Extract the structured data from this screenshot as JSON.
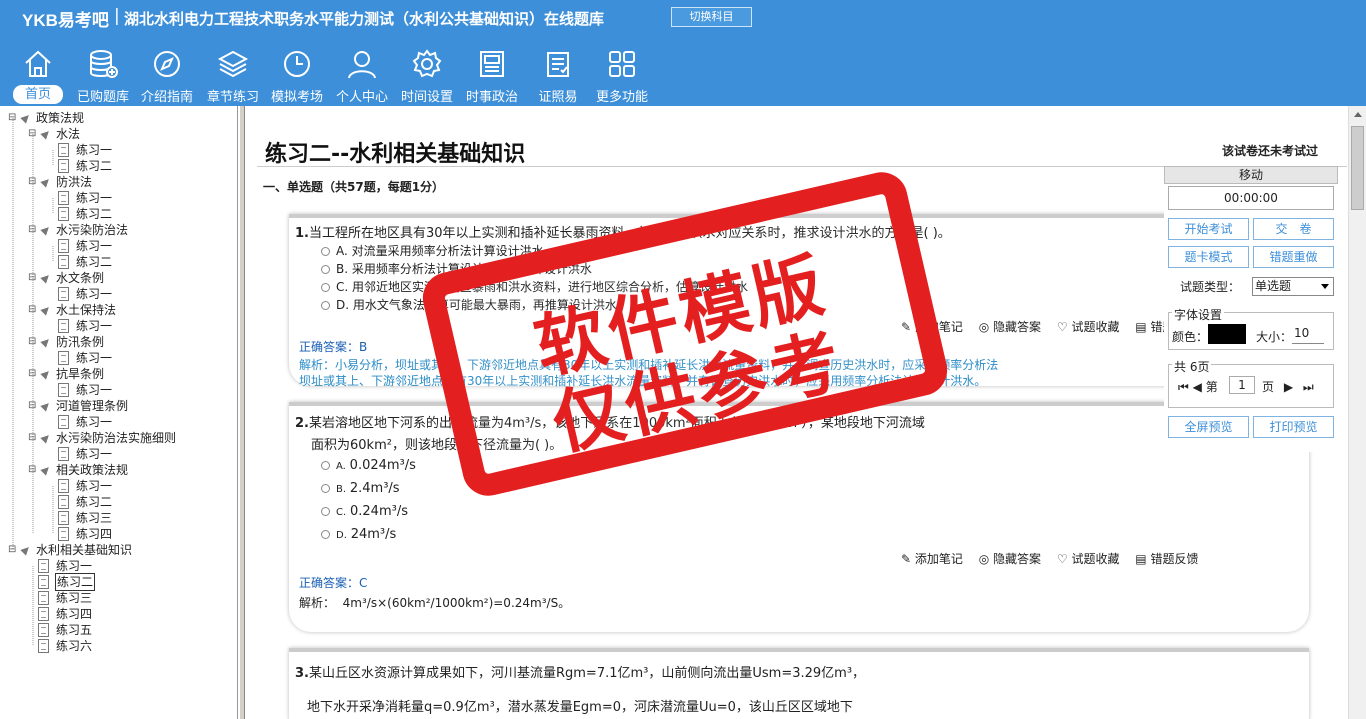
{
  "header": {
    "logo": "YKB易考吧",
    "title": "湖北水利电力工程技术职务水平能力测试（水利公共基础知识）在线题库",
    "switch_label": "切换科目"
  },
  "nav": [
    {
      "label": "首页",
      "icon": "home-icon"
    },
    {
      "label": "已购题库",
      "icon": "database-icon"
    },
    {
      "label": "介绍指南",
      "icon": "compass-icon"
    },
    {
      "label": "章节练习",
      "icon": "layers-icon"
    },
    {
      "label": "模拟考场",
      "icon": "clock-icon"
    },
    {
      "label": "个人中心",
      "icon": "user-icon"
    },
    {
      "label": "时间设置",
      "icon": "gear-icon"
    },
    {
      "label": "时事政治",
      "icon": "news-icon"
    },
    {
      "label": "证照易",
      "icon": "clipboard-icon"
    },
    {
      "label": "更多功能",
      "icon": "grid-icon"
    }
  ],
  "tree": [
    {
      "label": "政策法规",
      "level": 0,
      "kind": "folder"
    },
    {
      "label": "水法",
      "level": 1,
      "kind": "folder"
    },
    {
      "label": "练习一",
      "level": 2,
      "kind": "doc"
    },
    {
      "label": "练习二",
      "level": 2,
      "kind": "doc"
    },
    {
      "label": "防洪法",
      "level": 1,
      "kind": "folder"
    },
    {
      "label": "练习一",
      "level": 2,
      "kind": "doc"
    },
    {
      "label": "练习二",
      "level": 2,
      "kind": "doc"
    },
    {
      "label": "水污染防治法",
      "level": 1,
      "kind": "folder"
    },
    {
      "label": "练习一",
      "level": 2,
      "kind": "doc"
    },
    {
      "label": "练习二",
      "level": 2,
      "kind": "doc"
    },
    {
      "label": "水文条例",
      "level": 1,
      "kind": "folder"
    },
    {
      "label": "练习一",
      "level": 2,
      "kind": "doc"
    },
    {
      "label": "水土保持法",
      "level": 1,
      "kind": "folder"
    },
    {
      "label": "练习一",
      "level": 2,
      "kind": "doc"
    },
    {
      "label": "防汛条例",
      "level": 1,
      "kind": "folder"
    },
    {
      "label": "练习一",
      "level": 2,
      "kind": "doc"
    },
    {
      "label": "抗旱条例",
      "level": 1,
      "kind": "folder"
    },
    {
      "label": "练习一",
      "level": 2,
      "kind": "doc"
    },
    {
      "label": "河道管理条例",
      "level": 1,
      "kind": "folder"
    },
    {
      "label": "练习一",
      "level": 2,
      "kind": "doc"
    },
    {
      "label": "水污染防治法实施细则",
      "level": 1,
      "kind": "folder"
    },
    {
      "label": "练习一",
      "level": 2,
      "kind": "doc"
    },
    {
      "label": "相关政策法规",
      "level": 1,
      "kind": "folder"
    },
    {
      "label": "练习一",
      "level": 2,
      "kind": "doc"
    },
    {
      "label": "练习二",
      "level": 2,
      "kind": "doc"
    },
    {
      "label": "练习三",
      "level": 2,
      "kind": "doc"
    },
    {
      "label": "练习四",
      "level": 2,
      "kind": "doc"
    },
    {
      "label": "水利相关基础知识",
      "level": 0,
      "kind": "folder"
    },
    {
      "label": "练习一",
      "level": 1,
      "kind": "doc"
    },
    {
      "label": "练习二",
      "level": 1,
      "kind": "doc",
      "selected": true
    },
    {
      "label": "练习三",
      "level": 1,
      "kind": "doc"
    },
    {
      "label": "练习四",
      "level": 1,
      "kind": "doc"
    },
    {
      "label": "练习五",
      "level": 1,
      "kind": "doc"
    },
    {
      "label": "练习六",
      "level": 1,
      "kind": "doc"
    }
  ],
  "main": {
    "exam_title": "练习二--水利相关基础知识",
    "exam_status": "该试卷还未考试过",
    "section_title": "一、单选题（共57题，每题1分）",
    "q1": {
      "num": "1.",
      "text": "当工程所在地区具有30年以上实测和插补延长暴雨资料，并有暴雨洪水对应关系时，推求设计洪水的方法是(   )。",
      "options": [
        "A. 对流量采用频率分析法计算设计洪水",
        "B. 采用频率分析法计算设计暴雨，推算设计洪水",
        "C. 用邻近地区实测或调查暴雨和洪水资料，进行地区综合分析，估算设计洪水",
        "D. 用水文气象法估算可能最大暴雨，再推算设计洪水"
      ],
      "tools": [
        "添加笔记",
        "隐藏答案",
        "试题收藏",
        "错题反馈"
      ],
      "answer_label": "正确答案：",
      "answer": "B",
      "analysis_line1": "解析：小易分析，坝址或其上、下游邻近地点具有30年以上实测和插补延长洪水流量资料，并有调查历史洪水时，应采用频率分析法",
      "analysis_line2": "坝址或其上、下游邻近地点具有30年以上实测和插补延长洪水流量资料，并有调查历史洪水时，应采用频率分析法计算设计洪水。"
    },
    "q2": {
      "num": "2.",
      "text_line1": "某岩溶地区地下河系的出口流量为4m³/s，该地下河系在1000km²面积上分布（100l  ），某地段地下河流域",
      "text_line2": "面积为60km²，则该地段地下径流量为(   )。",
      "options": [
        {
          "letter": "A.",
          "value": "0.024m³/s"
        },
        {
          "letter": "B.",
          "value": "2.4m³/s"
        },
        {
          "letter": "C.",
          "value": "0.24m³/s"
        },
        {
          "letter": "D.",
          "value": "24m³/s"
        }
      ],
      "tools": [
        "添加笔记",
        "隐藏答案",
        "试题收藏",
        "错题反馈"
      ],
      "answer_label": "正确答案：",
      "answer": "C",
      "analysis_label": "解析：",
      "analysis": "4m³/s×(60km²/1000km²)=0.24m³/S。"
    },
    "q3": {
      "num": "3.",
      "text_line1": "某山丘区水资源计算成果如下，河川基流量Rgm=7.1亿m³，山前侧向流出量Usm=3.29亿m³，",
      "text_line2": "地下水开采净消耗量q=0.9亿m³，潜水蒸发量Egm=0，河床潜流量Uu=0，该山丘区区域地下"
    }
  },
  "panel": {
    "head": "移动",
    "timer": "00:00:00",
    "start_exam": "开始考试",
    "submit": "交　卷",
    "card_mode": "题卡模式",
    "redo_wrong": "错题重做",
    "type_label": "试题类型：",
    "type_value": "单选题",
    "font_settings": "字体设置",
    "color_label": "颜色：",
    "size_label": "大小：",
    "size_value": "10",
    "color_value": "#000000",
    "pages_label": "共 6页",
    "page_prefix": "第",
    "page_value": "1",
    "page_suffix": "页",
    "fullscreen": "全屏预览",
    "print": "打印预览"
  },
  "stamp": {
    "line1": "软件模版",
    "line2": "仅供参考",
    "color": "#e41f1f"
  }
}
